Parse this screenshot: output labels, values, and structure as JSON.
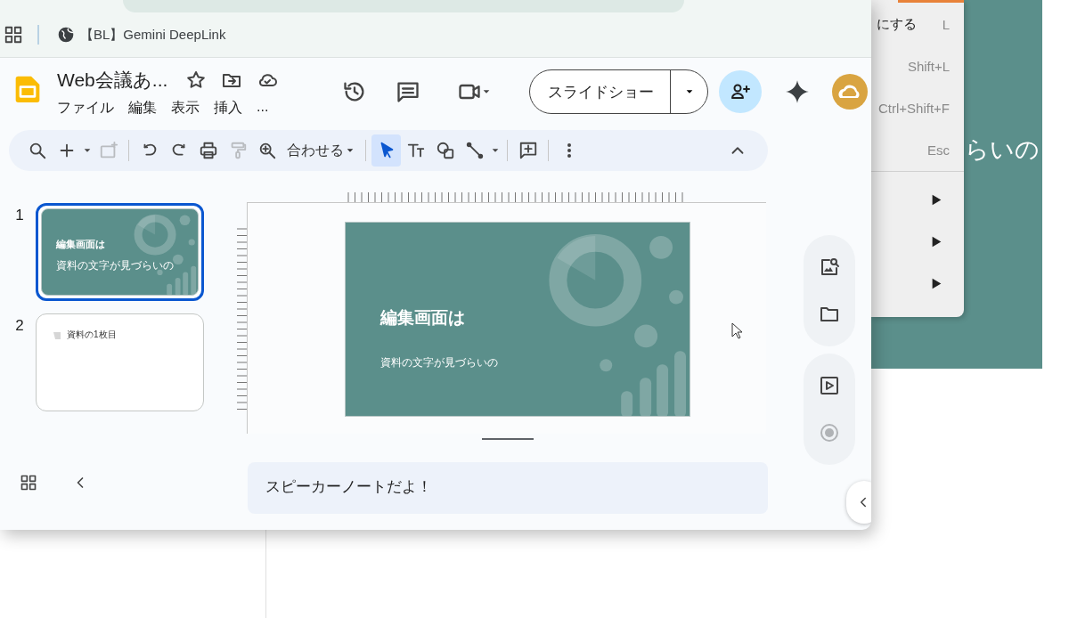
{
  "browser": {
    "bookmarks": [
      {
        "label": "【BL】Gemini DeepLink"
      }
    ]
  },
  "document": {
    "title": "Web会議あ...",
    "menus": [
      "ファイル",
      "編集",
      "表示",
      "挿入",
      "..."
    ],
    "slideshow_button": "スライドショー"
  },
  "toolbar": {
    "zoom": "合わせる",
    "pointer_selected": true,
    "new_slide_disabled": true,
    "paint_format_disabled": true
  },
  "slides": [
    {
      "number": "1",
      "kind": "title",
      "selected": true,
      "title": "編集画面は",
      "subtitle": "資料の文字が見づらいの"
    },
    {
      "number": "2",
      "kind": "content",
      "selected": false,
      "title": "資料の1枚目"
    }
  ],
  "current_slide": {
    "title": "編集画面は",
    "subtitle": "資料の文字が見づらいの"
  },
  "speaker_notes": "スピーカーノートだよ！",
  "background": {
    "menu": [
      {
        "label": "にする",
        "shortcut": "L"
      },
      {
        "shortcut": "Shift+L"
      },
      {
        "shortcut": "Ctrl+Shift+F"
      },
      {
        "shortcut": "Esc"
      },
      {
        "submenu": true
      },
      {
        "submenu": true
      },
      {
        "submenu": true
      }
    ],
    "slide_text": "らいの"
  }
}
